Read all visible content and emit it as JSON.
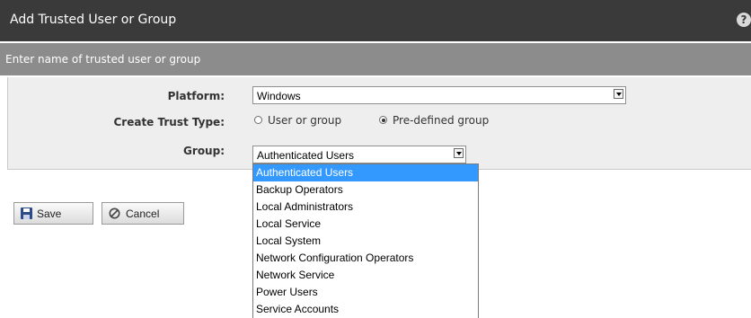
{
  "dialog": {
    "title": "Add Trusted User or Group",
    "help_icon": "help-icon",
    "subheader": "Enter name of trusted user or group"
  },
  "form": {
    "platform_label": "Platform:",
    "platform_value": "Windows",
    "trust_type_label": "Create Trust Type:",
    "trust_options": [
      {
        "label": "User or group",
        "selected": false
      },
      {
        "label": "Pre-defined group",
        "selected": true
      }
    ],
    "group_label": "Group:",
    "group_value": "Authenticated Users"
  },
  "group_dropdown": {
    "options": [
      "Authenticated Users",
      "Backup Operators",
      "Local Administrators",
      "Local Service",
      "Local System",
      "Network Configuration Operators",
      "Network Service",
      "Power Users",
      "Service Accounts"
    ],
    "highlighted": "Authenticated Users"
  },
  "buttons": {
    "save_label": "Save",
    "save_icon": "floppy-disk-icon",
    "cancel_label": "Cancel",
    "cancel_icon": "cancel-circle-icon"
  },
  "colors": {
    "titlebar": "#3a3a3a",
    "subheader": "#8c8c8c",
    "panel": "#eeeeee",
    "highlight": "#3399ff"
  }
}
